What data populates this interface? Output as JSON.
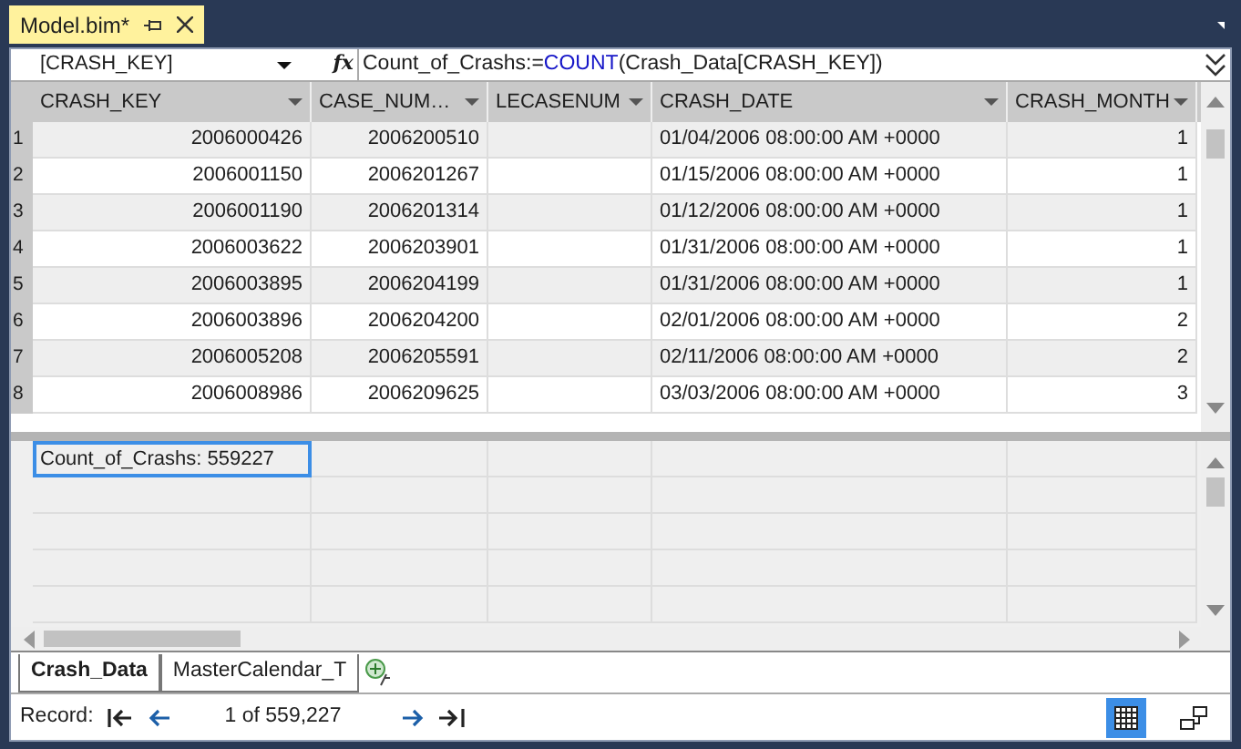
{
  "document_tab": {
    "title": "Model.bim*",
    "selected": true
  },
  "formula_bar": {
    "column_selector": "[CRASH_KEY]",
    "fx": "fx",
    "formula": [
      {
        "kind": "text",
        "text": "Count_of_Crashs:="
      },
      {
        "kind": "function",
        "text": "COUNT"
      },
      {
        "kind": "text",
        "text": "(Crash_Data[CRASH_KEY])"
      }
    ]
  },
  "table": {
    "columns": [
      "CRASH_KEY",
      "CASE_NUM…",
      "LECASENUM",
      "CRASH_DATE",
      "CRASH_MONTH"
    ],
    "rows": [
      {
        "number": "1",
        "cells": [
          "2006000426",
          "2006200510",
          "",
          "01/04/2006 08:00:00 AM +0000",
          "1"
        ]
      },
      {
        "number": "2",
        "cells": [
          "2006001150",
          "2006201267",
          "",
          "01/15/2006 08:00:00 AM +0000",
          "1"
        ]
      },
      {
        "number": "3",
        "cells": [
          "2006001190",
          "2006201314",
          "",
          "01/12/2006 08:00:00 AM +0000",
          "1"
        ]
      },
      {
        "number": "4",
        "cells": [
          "2006003622",
          "2006203901",
          "",
          "01/31/2006 08:00:00 AM +0000",
          "1"
        ]
      },
      {
        "number": "5",
        "cells": [
          "2006003895",
          "2006204199",
          "",
          "01/31/2006 08:00:00 AM +0000",
          "1"
        ]
      },
      {
        "number": "6",
        "cells": [
          "2006003896",
          "2006204200",
          "",
          "02/01/2006 08:00:00 AM +0000",
          "2"
        ]
      },
      {
        "number": "7",
        "cells": [
          "2006005208",
          "2006205591",
          "",
          "02/11/2006 08:00:00 AM +0000",
          "2"
        ]
      },
      {
        "number": "8",
        "cells": [
          "2006008986",
          "2006209625",
          "",
          "03/03/2006 08:00:00 AM +0000",
          "3"
        ]
      }
    ]
  },
  "measure_grid": {
    "measures": [
      {
        "text": "Count_of_Crashs: 559227",
        "selected": true
      }
    ]
  },
  "sheet_tabs": [
    {
      "label": "Crash_Data",
      "selected": true
    },
    {
      "label": "MasterCalendar_T",
      "selected": false
    }
  ],
  "record_bar": {
    "label": "Record:",
    "position": "1 of 559,227"
  }
}
